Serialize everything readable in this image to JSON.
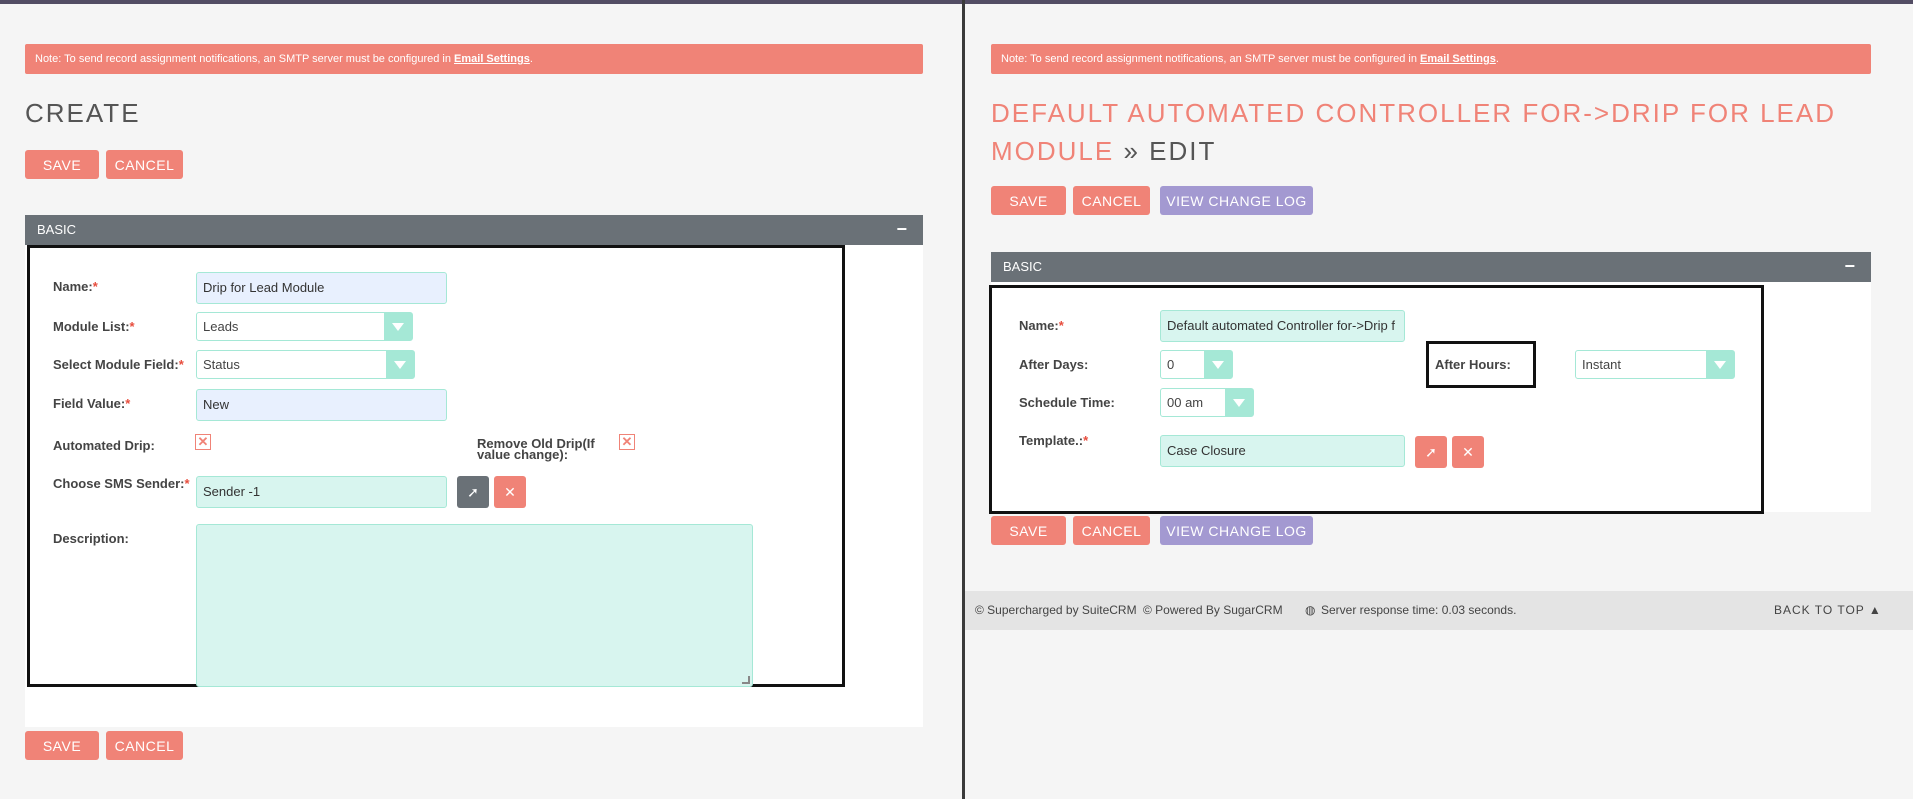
{
  "left": {
    "notice": {
      "text": "Note: To send record assignment notifications, an SMTP server must be configured in ",
      "link": "Email Settings",
      "tail": "."
    },
    "title": "CREATE",
    "buttons": {
      "save": "SAVE",
      "cancel": "CANCEL"
    },
    "panel": {
      "title": "BASIC",
      "collapse": "−"
    },
    "fields": {
      "name_label": "Name:",
      "name_value": "Drip for Lead Module",
      "module_list_label": "Module List:",
      "module_list_value": "Leads",
      "module_field_label": "Select Module Field:",
      "module_field_value": "Status",
      "field_value_label": "Field Value:",
      "field_value_value": "New",
      "automated_drip_label": "Automated Drip:",
      "remove_old_drip_label": "Remove Old Drip(If value change):",
      "sms_sender_label": "Choose SMS Sender:",
      "sms_sender_value": "Sender -1",
      "description_label": "Description:",
      "req": "*"
    }
  },
  "right": {
    "notice": {
      "text": "Note: To send record assignment notifications, an SMTP server must be configured in ",
      "link": "Email Settings",
      "tail": "."
    },
    "title_line1": "DEFAULT AUTOMATED CONTROLLER FOR->DRIP FOR LEAD",
    "title_line2_accent": "MODULE",
    "title_line2_rest": " » EDIT",
    "buttons": {
      "save": "SAVE",
      "cancel": "CANCEL",
      "view_change_log": "VIEW CHANGE LOG"
    },
    "panel": {
      "title": "BASIC",
      "collapse": "−"
    },
    "fields": {
      "name_label": "Name:",
      "name_value": "Default automated Controller for->Drip f",
      "after_days_label": "After Days:",
      "after_days_value": "0",
      "after_hours_label": "After Hours:",
      "after_hours_value": "Instant",
      "schedule_time_label": "Schedule Time:",
      "schedule_time_value": "00 am",
      "template_label": "Template.:",
      "template_value": "Case Closure",
      "req": "*"
    },
    "footer": {
      "supercharged": "© Supercharged by SuiteCRM",
      "powered": "© Powered By SugarCRM",
      "response": "Server response time: 0.03 seconds.",
      "back_to_top": "BACK TO TOP ▲"
    }
  },
  "colors": {
    "accent": "#f08377",
    "panel_header": "#6a7177",
    "field_border": "#a5e8d6",
    "purple_button": "#a399d1"
  },
  "icons": [
    "select-arrow-icon",
    "clear-x-icon",
    "checkbox-x-icon",
    "dropdown-arrow-icon",
    "globe-icon"
  ]
}
